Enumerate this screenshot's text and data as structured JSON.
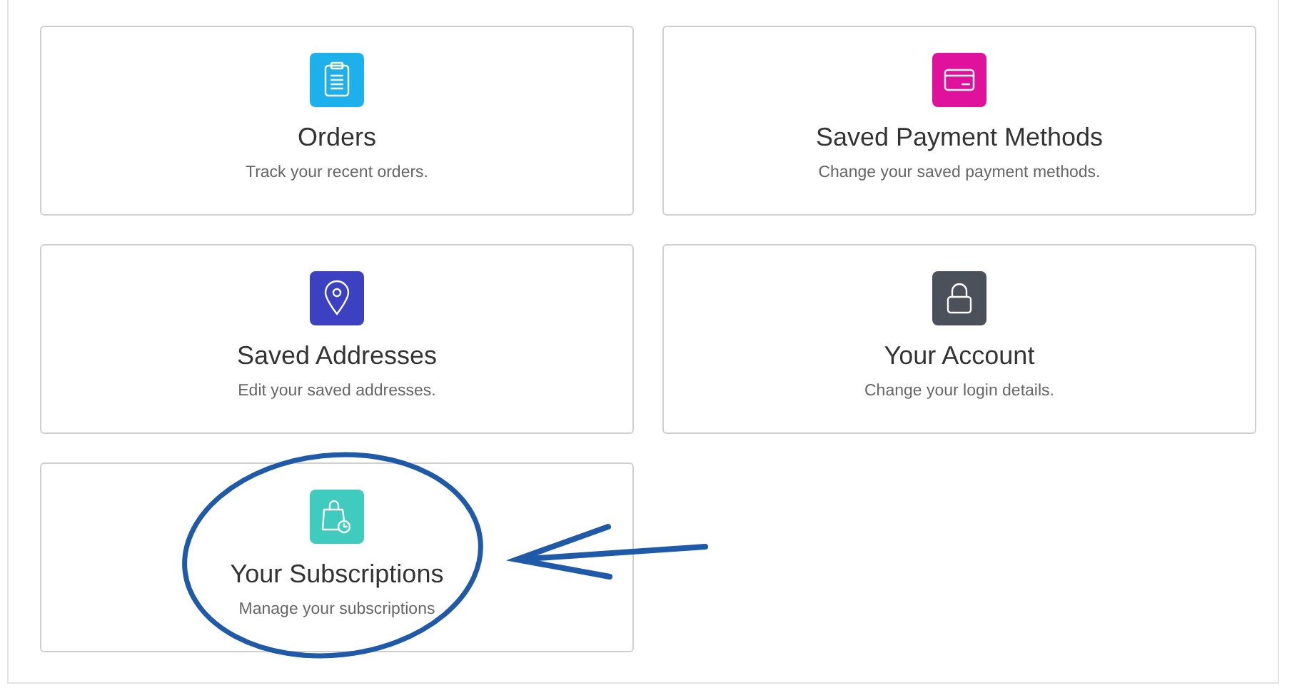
{
  "cards": [
    {
      "kind": "clipboard",
      "color": "#1cb0ec",
      "title": "Orders",
      "description": "Track your recent orders."
    },
    {
      "kind": "card",
      "color": "#e0119d",
      "title": "Saved Payment Methods",
      "description": "Change your saved payment methods."
    },
    {
      "kind": "pin",
      "color": "#3c41c1",
      "title": "Saved Addresses",
      "description": "Edit your saved addresses."
    },
    {
      "kind": "lock",
      "color": "#4a515b",
      "title": "Your Account",
      "description": "Change your login details."
    },
    {
      "kind": "bag",
      "color": "#3fcbbd",
      "title": "Your Subscriptions",
      "description": "Manage your subscriptions"
    }
  ]
}
